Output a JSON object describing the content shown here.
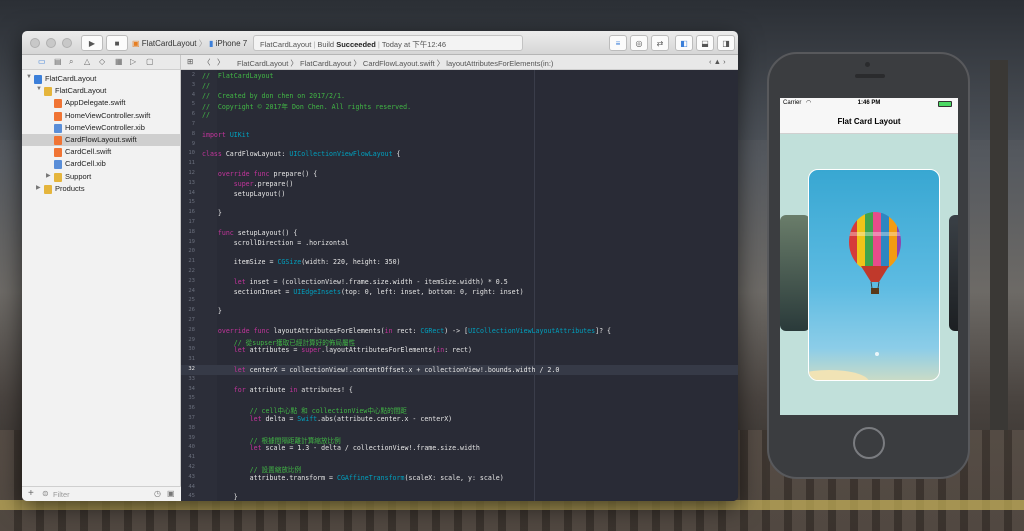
{
  "xcode": {
    "scheme_app": "FlatCardLayout",
    "scheme_device": "iPhone 7",
    "status_app": "FlatCardLayout",
    "status_build_prefix": "Build",
    "status_build_result": "Succeeded",
    "status_time": "Today at 下午12:46",
    "warning_count": "2",
    "jumpbar": [
      "FlatCardLayout",
      "FlatCardLayout",
      "CardFlowLayout.swift",
      "layoutAttributesForElements(in:)"
    ],
    "filter_placeholder": "Filter"
  },
  "navigator": [
    {
      "label": "FlatCardLayout",
      "level": 0,
      "kind": "project"
    },
    {
      "label": "FlatCardLayout",
      "level": 1,
      "kind": "folder"
    },
    {
      "label": "AppDelegate.swift",
      "level": 2,
      "kind": "swift"
    },
    {
      "label": "HomeViewController.swift",
      "level": 2,
      "kind": "swift"
    },
    {
      "label": "HomeViewController.xib",
      "level": 2,
      "kind": "xib"
    },
    {
      "label": "CardFlowLayout.swift",
      "level": 2,
      "kind": "swift",
      "selected": true
    },
    {
      "label": "CardCell.swift",
      "level": 2,
      "kind": "swift"
    },
    {
      "label": "CardCell.xib",
      "level": 2,
      "kind": "xib"
    },
    {
      "label": "Support",
      "level": 2,
      "kind": "folder"
    },
    {
      "label": "Products",
      "level": 1,
      "kind": "folder"
    }
  ],
  "code_lines": [
    {
      "n": "2",
      "text": "//  FlatCardLayout",
      "kind": "comment"
    },
    {
      "n": "3",
      "text": "//",
      "kind": "comment"
    },
    {
      "n": "4",
      "text": "//  Created by don chen on 2017/2/1.",
      "kind": "comment"
    },
    {
      "n": "5",
      "text": "//  Copyright © 2017年 Don Chen. All rights reserved.",
      "kind": "comment"
    },
    {
      "n": "6",
      "text": "//",
      "kind": "comment"
    },
    {
      "n": "7",
      "text": "",
      "kind": "plain"
    },
    {
      "n": "8",
      "text": "import UIKit",
      "kind": "plain"
    },
    {
      "n": "9",
      "text": "",
      "kind": "plain"
    },
    {
      "n": "10",
      "text": "class CardFlowLayout: UICollectionViewFlowLayout {",
      "kind": "plain"
    },
    {
      "n": "11",
      "text": "",
      "kind": "plain"
    },
    {
      "n": "12",
      "text": "    override func prepare() {",
      "kind": "plain"
    },
    {
      "n": "13",
      "text": "        super.prepare()",
      "kind": "plain"
    },
    {
      "n": "14",
      "text": "        setupLayout()",
      "kind": "plain"
    },
    {
      "n": "15",
      "text": "",
      "kind": "plain"
    },
    {
      "n": "16",
      "text": "    }",
      "kind": "plain"
    },
    {
      "n": "17",
      "text": "",
      "kind": "plain"
    },
    {
      "n": "18",
      "text": "    func setupLayout() {",
      "kind": "plain"
    },
    {
      "n": "19",
      "text": "        scrollDirection = .horizontal",
      "kind": "plain"
    },
    {
      "n": "20",
      "text": "",
      "kind": "plain"
    },
    {
      "n": "21",
      "text": "        itemSize = CGSize(width: 220, height: 350)",
      "kind": "plain"
    },
    {
      "n": "22",
      "text": "",
      "kind": "plain"
    },
    {
      "n": "23",
      "text": "        let inset = (collectionView!.frame.size.width - itemSize.width) * 0.5",
      "kind": "plain"
    },
    {
      "n": "24",
      "text": "        sectionInset = UIEdgeInsets(top: 0, left: inset, bottom: 0, right: inset)",
      "kind": "plain"
    },
    {
      "n": "25",
      "text": "",
      "kind": "plain"
    },
    {
      "n": "26",
      "text": "    }",
      "kind": "plain"
    },
    {
      "n": "27",
      "text": "",
      "kind": "plain"
    },
    {
      "n": "28",
      "text": "    override func layoutAttributesForElements(in rect: CGRect) -> [UICollectionViewLayoutAttributes]? {",
      "kind": "plain"
    },
    {
      "n": "29",
      "text": "        // 從supser獲取已經計算好的佈局屬性",
      "kind": "comment"
    },
    {
      "n": "30",
      "text": "        let attributes = super.layoutAttributesForElements(in: rect)",
      "kind": "plain"
    },
    {
      "n": "31",
      "text": "",
      "kind": "plain"
    },
    {
      "n": "32",
      "text": "        let centerX = collectionView!.contentOffset.x + collectionView!.bounds.width / 2.0",
      "kind": "plain",
      "current": true
    },
    {
      "n": "33",
      "text": "",
      "kind": "plain"
    },
    {
      "n": "34",
      "text": "        for attribute in attributes! {",
      "kind": "plain"
    },
    {
      "n": "35",
      "text": "",
      "kind": "plain"
    },
    {
      "n": "36",
      "text": "            // cell中心點 和 collectionView中心點的間距",
      "kind": "comment"
    },
    {
      "n": "37",
      "text": "            let delta = Swift.abs(attribute.center.x - centerX)",
      "kind": "plain"
    },
    {
      "n": "38",
      "text": "",
      "kind": "plain"
    },
    {
      "n": "39",
      "text": "            // 根據間隔距離計算縮放比例",
      "kind": "comment"
    },
    {
      "n": "40",
      "text": "            let scale = 1.3 - delta / collectionView!.frame.size.width",
      "kind": "plain"
    },
    {
      "n": "41",
      "text": "",
      "kind": "plain"
    },
    {
      "n": "42",
      "text": "            // 設置縮放比例",
      "kind": "comment"
    },
    {
      "n": "43",
      "text": "            attribute.transform = CGAffineTransform(scaleX: scale, y: scale)",
      "kind": "plain"
    },
    {
      "n": "44",
      "text": "",
      "kind": "plain"
    },
    {
      "n": "45",
      "text": "        }",
      "kind": "plain"
    }
  ],
  "simulator": {
    "carrier": "Carrier",
    "time": "1:46 PM",
    "nav_title": "Flat Card Layout"
  },
  "colors": {
    "editor_bg": "#292b36",
    "comment": "#41b645",
    "keyword": "#c2349b",
    "type": "#00a0be",
    "selection": "#cfcfcf"
  }
}
